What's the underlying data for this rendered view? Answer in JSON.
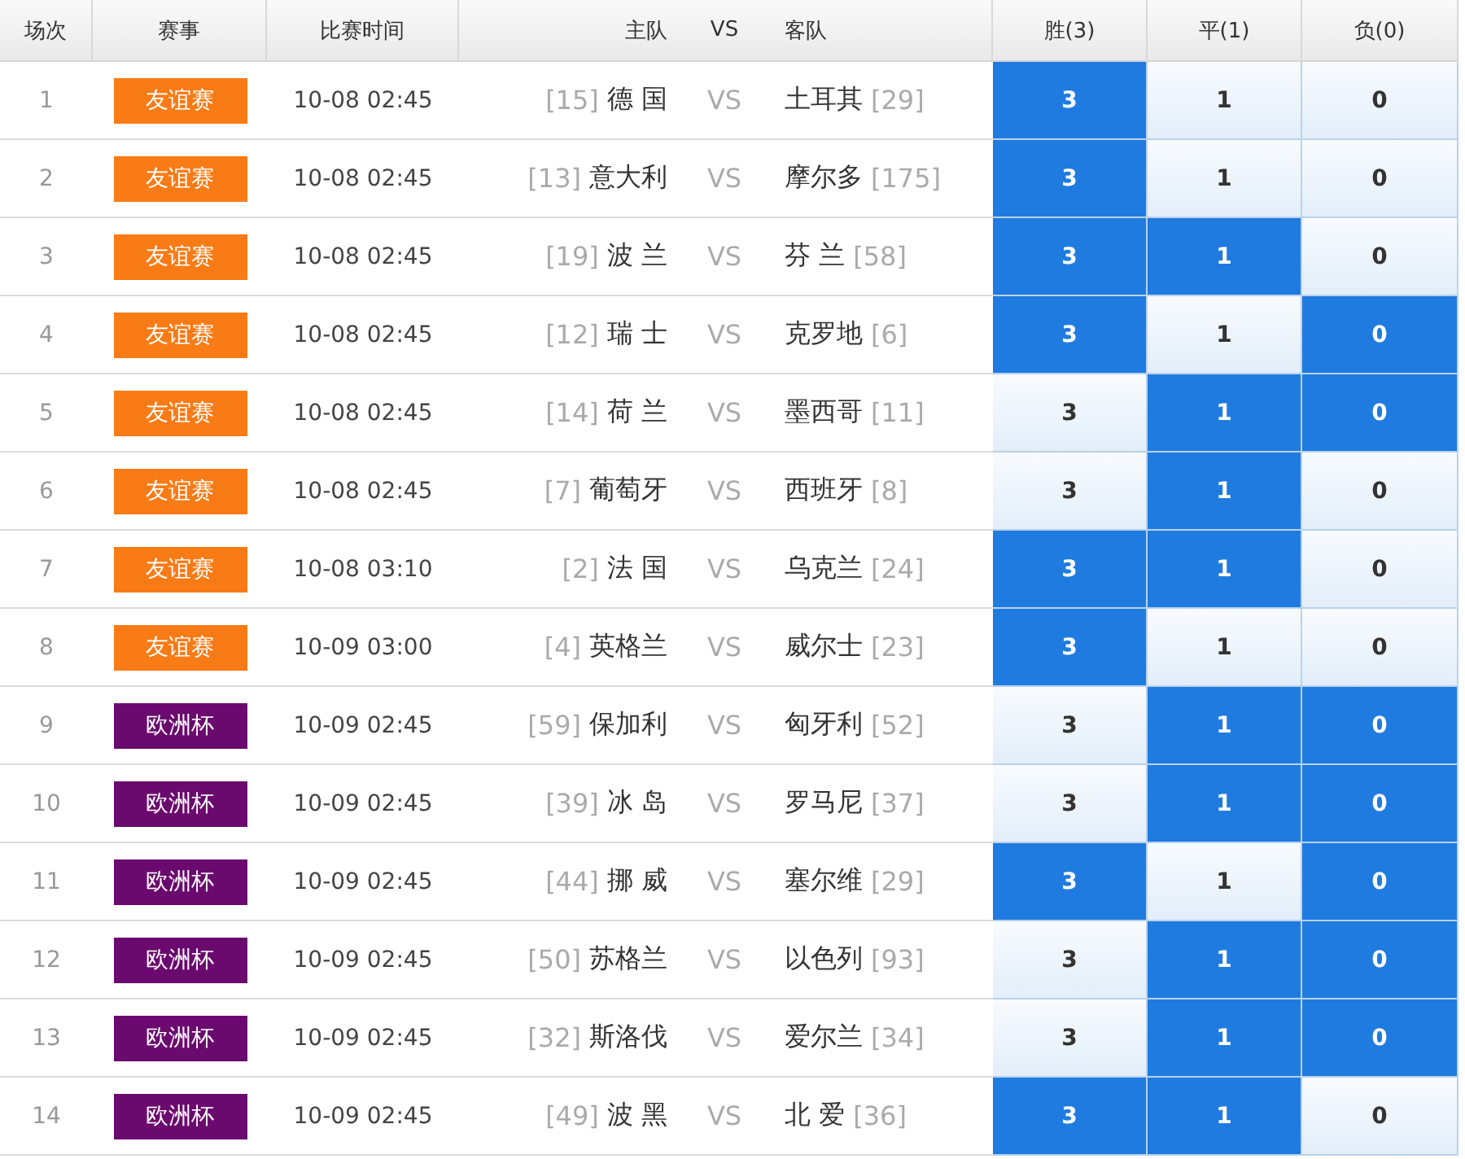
{
  "columns": [
    "场次",
    "赛事",
    "比赛时间",
    "主队",
    "VS",
    "客队",
    "胜(3)",
    "平(1)",
    "负(0)"
  ],
  "rows": [
    {
      "no": "1",
      "league": "友谊赛",
      "color": "#f97b16",
      "time": "10-08 02:45",
      "home_rank": "[15]",
      "home": "德 国",
      "vs": "VS",
      "away": "土耳其",
      "away_rank": "[29]",
      "picks": [
        {
          "label": "3",
          "selected": true
        },
        {
          "label": "1",
          "selected": false
        },
        {
          "label": "0",
          "selected": false
        }
      ]
    },
    {
      "no": "2",
      "league": "友谊赛",
      "color": "#f97b16",
      "time": "10-08 02:45",
      "home_rank": "[13]",
      "home": "意大利",
      "vs": "VS",
      "away": "摩尔多",
      "away_rank": "[175]",
      "picks": [
        {
          "label": "3",
          "selected": true
        },
        {
          "label": "1",
          "selected": false
        },
        {
          "label": "0",
          "selected": false
        }
      ]
    },
    {
      "no": "3",
      "league": "友谊赛",
      "color": "#f97b16",
      "time": "10-08 02:45",
      "home_rank": "[19]",
      "home": "波 兰",
      "vs": "VS",
      "away": "芬 兰",
      "away_rank": "[58]",
      "picks": [
        {
          "label": "3",
          "selected": true
        },
        {
          "label": "1",
          "selected": true
        },
        {
          "label": "0",
          "selected": false
        }
      ]
    },
    {
      "no": "4",
      "league": "友谊赛",
      "color": "#f97b16",
      "time": "10-08 02:45",
      "home_rank": "[12]",
      "home": "瑞 士",
      "vs": "VS",
      "away": "克罗地",
      "away_rank": "[6]",
      "picks": [
        {
          "label": "3",
          "selected": true
        },
        {
          "label": "1",
          "selected": false
        },
        {
          "label": "0",
          "selected": true
        }
      ]
    },
    {
      "no": "5",
      "league": "友谊赛",
      "color": "#f97b16",
      "time": "10-08 02:45",
      "home_rank": "[14]",
      "home": "荷 兰",
      "vs": "VS",
      "away": "墨西哥",
      "away_rank": "[11]",
      "picks": [
        {
          "label": "3",
          "selected": false
        },
        {
          "label": "1",
          "selected": true
        },
        {
          "label": "0",
          "selected": true
        }
      ]
    },
    {
      "no": "6",
      "league": "友谊赛",
      "color": "#f97b16",
      "time": "10-08 02:45",
      "home_rank": "[7]",
      "home": "葡萄牙",
      "vs": "VS",
      "away": "西班牙",
      "away_rank": "[8]",
      "picks": [
        {
          "label": "3",
          "selected": false
        },
        {
          "label": "1",
          "selected": true
        },
        {
          "label": "0",
          "selected": false
        }
      ]
    },
    {
      "no": "7",
      "league": "友谊赛",
      "color": "#f97b16",
      "time": "10-08 03:10",
      "home_rank": "[2]",
      "home": "法 国",
      "vs": "VS",
      "away": "乌克兰",
      "away_rank": "[24]",
      "picks": [
        {
          "label": "3",
          "selected": true
        },
        {
          "label": "1",
          "selected": true
        },
        {
          "label": "0",
          "selected": false
        }
      ]
    },
    {
      "no": "8",
      "league": "友谊赛",
      "color": "#f97b16",
      "time": "10-09 03:00",
      "home_rank": "[4]",
      "home": "英格兰",
      "vs": "VS",
      "away": "威尔士",
      "away_rank": "[23]",
      "picks": [
        {
          "label": "3",
          "selected": true
        },
        {
          "label": "1",
          "selected": false
        },
        {
          "label": "0",
          "selected": false
        }
      ]
    },
    {
      "no": "9",
      "league": "欧洲杯",
      "color": "#6b0a6e",
      "time": "10-09 02:45",
      "home_rank": "[59]",
      "home": "保加利",
      "vs": "VS",
      "away": "匈牙利",
      "away_rank": "[52]",
      "picks": [
        {
          "label": "3",
          "selected": false
        },
        {
          "label": "1",
          "selected": true
        },
        {
          "label": "0",
          "selected": true
        }
      ]
    },
    {
      "no": "10",
      "league": "欧洲杯",
      "color": "#6b0a6e",
      "time": "10-09 02:45",
      "home_rank": "[39]",
      "home": "冰 岛",
      "vs": "VS",
      "away": "罗马尼",
      "away_rank": "[37]",
      "picks": [
        {
          "label": "3",
          "selected": false
        },
        {
          "label": "1",
          "selected": true
        },
        {
          "label": "0",
          "selected": true
        }
      ]
    },
    {
      "no": "11",
      "league": "欧洲杯",
      "color": "#6b0a6e",
      "time": "10-09 02:45",
      "home_rank": "[44]",
      "home": "挪 威",
      "vs": "VS",
      "away": "塞尔维",
      "away_rank": "[29]",
      "picks": [
        {
          "label": "3",
          "selected": true
        },
        {
          "label": "1",
          "selected": false
        },
        {
          "label": "0",
          "selected": true
        }
      ]
    },
    {
      "no": "12",
      "league": "欧洲杯",
      "color": "#6b0a6e",
      "time": "10-09 02:45",
      "home_rank": "[50]",
      "home": "苏格兰",
      "vs": "VS",
      "away": "以色列",
      "away_rank": "[93]",
      "picks": [
        {
          "label": "3",
          "selected": false
        },
        {
          "label": "1",
          "selected": true
        },
        {
          "label": "0",
          "selected": true
        }
      ]
    },
    {
      "no": "13",
      "league": "欧洲杯",
      "color": "#6b0a6e",
      "time": "10-09 02:45",
      "home_rank": "[32]",
      "home": "斯洛伐",
      "vs": "VS",
      "away": "爱尔兰",
      "away_rank": "[34]",
      "picks": [
        {
          "label": "3",
          "selected": false
        },
        {
          "label": "1",
          "selected": true
        },
        {
          "label": "0",
          "selected": true
        }
      ]
    },
    {
      "no": "14",
      "league": "欧洲杯",
      "color": "#6b0a6e",
      "time": "10-09 02:45",
      "home_rank": "[49]",
      "home": "波 黑",
      "vs": "VS",
      "away": "北 爱",
      "away_rank": "[36]",
      "picks": [
        {
          "label": "3",
          "selected": true
        },
        {
          "label": "1",
          "selected": true
        },
        {
          "label": "0",
          "selected": false
        }
      ]
    }
  ]
}
